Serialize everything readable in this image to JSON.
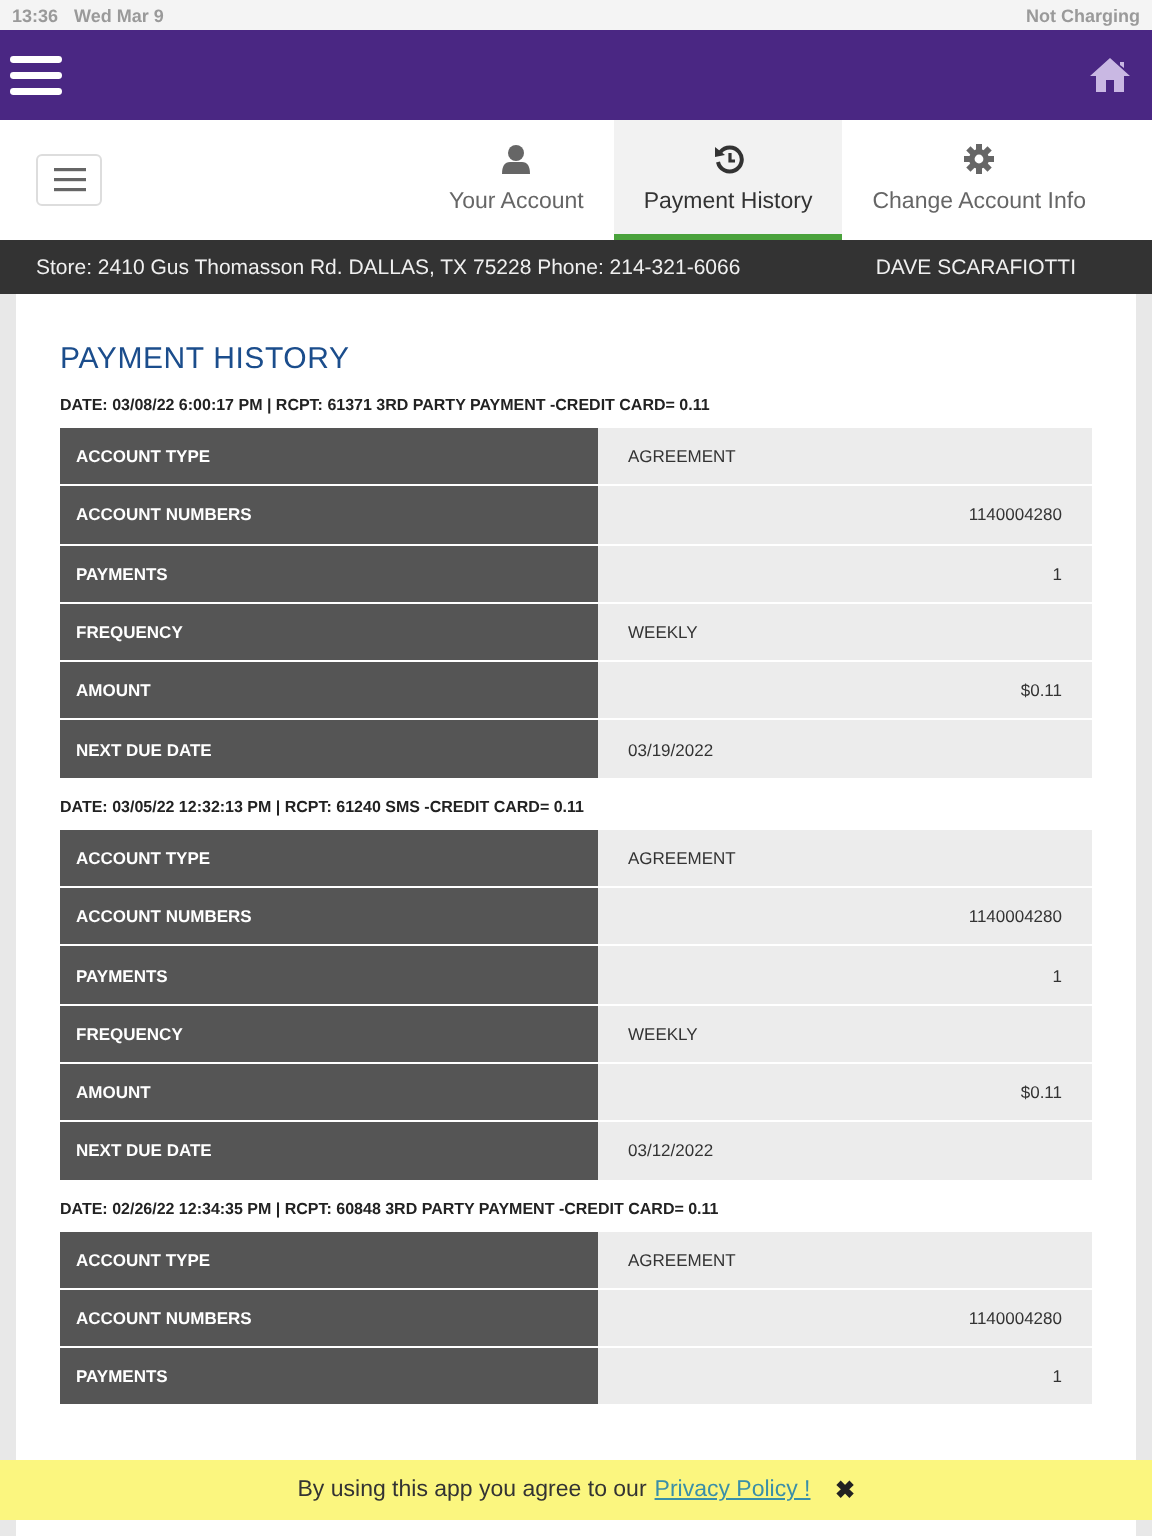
{
  "status_bar": {
    "time": "13:36",
    "date": "Wed Mar 9",
    "battery": "Not Charging"
  },
  "nav_tabs": [
    {
      "label": "Your Account",
      "selected": false
    },
    {
      "label": "Payment History",
      "selected": true
    },
    {
      "label": "Change Account Info",
      "selected": false
    }
  ],
  "store_bar": {
    "store": "Store: 2410 Gus Thomasson Rd. DALLAS, TX 75228 Phone: 214-321-6066",
    "customer": "DAVE SCARAFIOTTI"
  },
  "title": "PAYMENT HISTORY",
  "payments": [
    {
      "heading": "DATE: 03/08/22 6:00:17 PM | RCPT: 61371 3RD PARTY PAYMENT -CREDIT CARD= 0.11",
      "rows": [
        {
          "label": "ACCOUNT TYPE",
          "value": "AGREEMENT",
          "kind": "text"
        },
        {
          "label": "ACCOUNT NUMBERS",
          "value": "1140004280",
          "kind": "number"
        },
        {
          "label": "PAYMENTS",
          "value": "1",
          "kind": "number"
        },
        {
          "label": "FREQUENCY",
          "value": "WEEKLY",
          "kind": "text"
        },
        {
          "label": "AMOUNT",
          "value": "$0.11",
          "kind": "number"
        },
        {
          "label": "NEXT DUE DATE",
          "value": "03/19/2022",
          "kind": "text"
        }
      ]
    },
    {
      "heading": "DATE: 03/05/22 12:32:13 PM | RCPT: 61240 SMS -CREDIT CARD= 0.11",
      "rows": [
        {
          "label": "ACCOUNT TYPE",
          "value": "AGREEMENT",
          "kind": "text"
        },
        {
          "label": "ACCOUNT NUMBERS",
          "value": "1140004280",
          "kind": "number"
        },
        {
          "label": "PAYMENTS",
          "value": "1",
          "kind": "number"
        },
        {
          "label": "FREQUENCY",
          "value": "WEEKLY",
          "kind": "text"
        },
        {
          "label": "AMOUNT",
          "value": "$0.11",
          "kind": "number"
        },
        {
          "label": "NEXT DUE DATE",
          "value": "03/12/2022",
          "kind": "text"
        }
      ]
    },
    {
      "heading": "DATE: 02/26/22 12:34:35 PM | RCPT: 60848 3RD PARTY PAYMENT -CREDIT CARD= 0.11",
      "rows": [
        {
          "label": "ACCOUNT TYPE",
          "value": "AGREEMENT",
          "kind": "text"
        },
        {
          "label": "ACCOUNT NUMBERS",
          "value": "1140004280",
          "kind": "number"
        },
        {
          "label": "PAYMENTS",
          "value": "1",
          "kind": "number"
        }
      ]
    }
  ],
  "banner": {
    "text": "By using this app you agree to our",
    "link": "Privacy Policy !",
    "close": "✖"
  }
}
